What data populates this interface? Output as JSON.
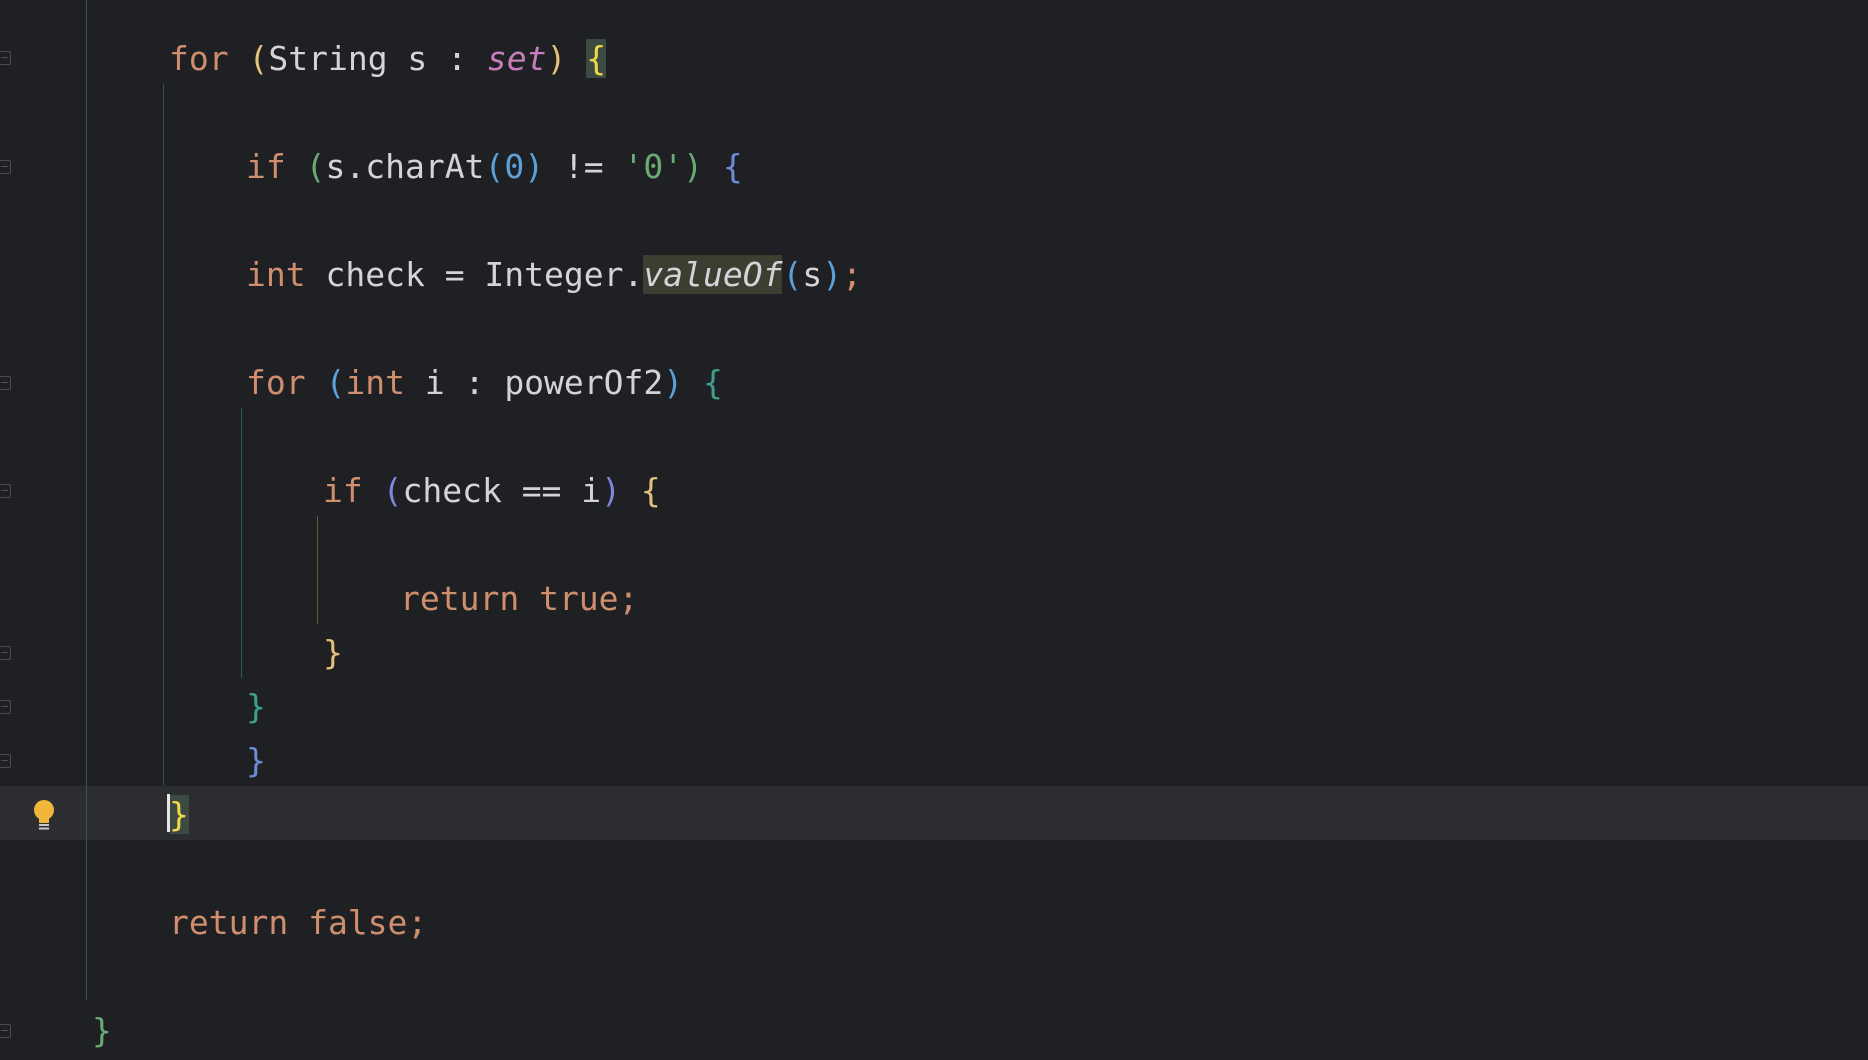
{
  "editor": {
    "language": "java",
    "lines": [
      {
        "tokens": [
          {
            "text": "for ",
            "cls": "kw"
          },
          {
            "text": "(",
            "color": "#e5c07b"
          },
          {
            "text": "String s : ",
            "cls": "pu"
          },
          {
            "text": "set",
            "cls": "fld"
          },
          {
            "text": ")",
            "color": "#e5c07b"
          },
          {
            "text": " "
          },
          {
            "text": "{",
            "color": "#f0d94a",
            "hl": "brace"
          }
        ]
      },
      {
        "tokens": [
          {
            "text": "if ",
            "cls": "kw"
          },
          {
            "text": "(",
            "color": "#6aab73"
          },
          {
            "text": "s.charAt",
            "cls": "pu"
          },
          {
            "text": "(",
            "color": "#5da0d8"
          },
          {
            "text": "0",
            "cls": "num"
          },
          {
            "text": ")",
            "color": "#5da0d8"
          },
          {
            "text": " != ",
            "cls": "pu"
          },
          {
            "text": "'0'",
            "cls": "str"
          },
          {
            "text": ")",
            "color": "#6aab73"
          },
          {
            "text": " "
          },
          {
            "text": "{",
            "color": "#6f8bd8"
          }
        ]
      },
      {
        "tokens": [
          {
            "text": "int ",
            "cls": "kw"
          },
          {
            "text": "check = Integer.",
            "cls": "pu"
          },
          {
            "text": "valueOf",
            "cls": "mth",
            "hl": "match"
          },
          {
            "text": "(",
            "color": "#5da0d8"
          },
          {
            "text": "s",
            "cls": "pu"
          },
          {
            "text": ")",
            "color": "#5da0d8"
          },
          {
            "text": ";",
            "cls": "kw"
          }
        ]
      },
      {
        "tokens": [
          {
            "text": "for ",
            "cls": "kw"
          },
          {
            "text": "(",
            "color": "#5da0d8"
          },
          {
            "text": "int ",
            "cls": "kw"
          },
          {
            "text": "i : powerOf2",
            "cls": "pu"
          },
          {
            "text": ")",
            "color": "#5da0d8"
          },
          {
            "text": " "
          },
          {
            "text": "{",
            "color": "#3f9f8f"
          }
        ]
      },
      {
        "tokens": [
          {
            "text": "if ",
            "cls": "kw"
          },
          {
            "text": "(",
            "color": "#7f86e0"
          },
          {
            "text": "check == i",
            "cls": "pu"
          },
          {
            "text": ")",
            "color": "#7f86e0"
          },
          {
            "text": " "
          },
          {
            "text": "{",
            "color": "#e5c07b"
          }
        ]
      },
      {
        "tokens": [
          {
            "text": "return true;",
            "cls": "kw"
          }
        ]
      },
      {
        "tokens": [
          {
            "text": "}",
            "color": "#e5c07b"
          }
        ]
      },
      {
        "tokens": [
          {
            "text": "}",
            "color": "#3f9f8f"
          }
        ]
      },
      {
        "tokens": [
          {
            "text": "}",
            "color": "#6f8bd8"
          }
        ]
      },
      {
        "tokens": [
          {
            "text": "}",
            "color": "#f0d94a",
            "hl": "brace"
          }
        ]
      },
      {
        "tokens": [
          {
            "text": "return false;",
            "cls": "kw"
          }
        ]
      },
      {
        "tokens": [
          {
            "text": "}",
            "color": "#6aab73"
          }
        ]
      }
    ],
    "gutter_icon": "lightbulb-icon",
    "colors": {
      "background": "#1f2023",
      "current_line": "#2b2d30",
      "keyword": "#cf8e6d",
      "plain": "#d2d4d8",
      "field": "#c77dbb",
      "number": "#5da0d8",
      "string": "#6aab73"
    }
  }
}
